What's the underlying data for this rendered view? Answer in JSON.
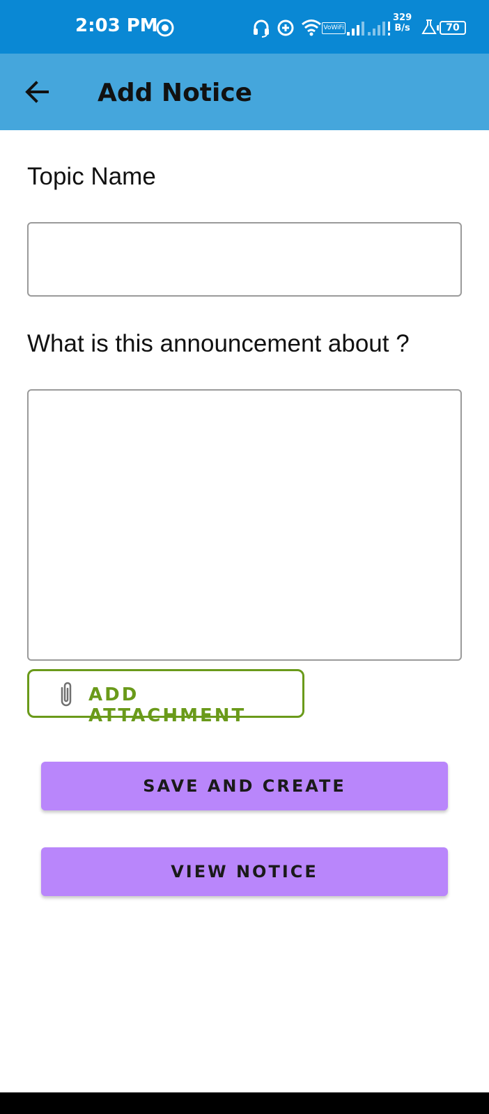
{
  "status_bar": {
    "time": "2:03 PM",
    "speed_value": "329",
    "speed_unit": "B/s",
    "battery": "70",
    "vowifi": "VoWiFi",
    "icons": [
      "record-icon",
      "headset-icon",
      "data-saver-icon",
      "wifi-icon",
      "vowifi-icon",
      "signal-icon",
      "signal-2-icon",
      "lab-icon",
      "battery-icon"
    ]
  },
  "app_bar": {
    "title": "Add Notice",
    "back_icon": "arrow-left-icon"
  },
  "form": {
    "topic_label": "Topic Name",
    "topic_value": "",
    "about_label": "What is this announcement about ?",
    "about_value": "",
    "attach_label": "ADD ATTACHMENT",
    "attach_icon": "paperclip-icon"
  },
  "actions": {
    "save_label": "SAVE AND CREATE",
    "view_label": "VIEW NOTICE"
  },
  "colors": {
    "status_bar": "#0a88d4",
    "app_bar": "#45a6dc",
    "accent_green": "#6a9a1a",
    "button_purple": "#b986fb"
  }
}
